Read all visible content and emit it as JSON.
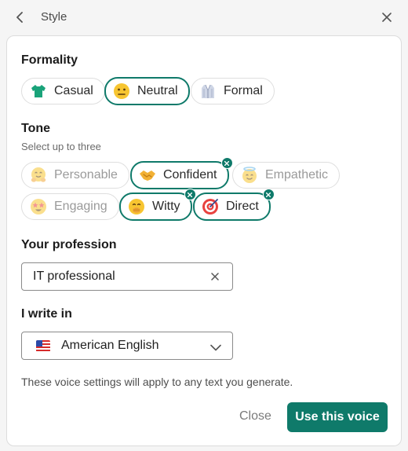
{
  "header": {
    "title": "Style"
  },
  "formality": {
    "title": "Formality",
    "options": [
      {
        "label": "Casual",
        "icon": "t-shirt-icon",
        "selected": false
      },
      {
        "label": "Neutral",
        "icon": "neutral-face-icon",
        "selected": true
      },
      {
        "label": "Formal",
        "icon": "suit-icon",
        "selected": false
      }
    ]
  },
  "tone": {
    "title": "Tone",
    "subtitle": "Select up to three",
    "options": [
      {
        "label": "Personable",
        "icon": "hugging-face-icon",
        "selected": false
      },
      {
        "label": "Confident",
        "icon": "handshake-icon",
        "selected": true
      },
      {
        "label": "Empathetic",
        "icon": "smiling-face-halo-icon",
        "selected": false
      },
      {
        "label": "Engaging",
        "icon": "star-struck-icon",
        "selected": false
      },
      {
        "label": "Witty",
        "icon": "face-hand-over-mouth-icon",
        "selected": true
      },
      {
        "label": "Direct",
        "icon": "bullseye-icon",
        "selected": true
      }
    ]
  },
  "profession": {
    "title": "Your profession",
    "value": "IT professional"
  },
  "language": {
    "title": "I write in",
    "value": "American English",
    "icon": "us-flag-icon"
  },
  "footnote": "These voice settings will apply to any text you generate.",
  "actions": {
    "close_label": "Close",
    "primary_label": "Use this voice"
  },
  "colors": {
    "accent": "#0f7a6a",
    "background": "#f5f5f5",
    "card": "#ffffff"
  }
}
